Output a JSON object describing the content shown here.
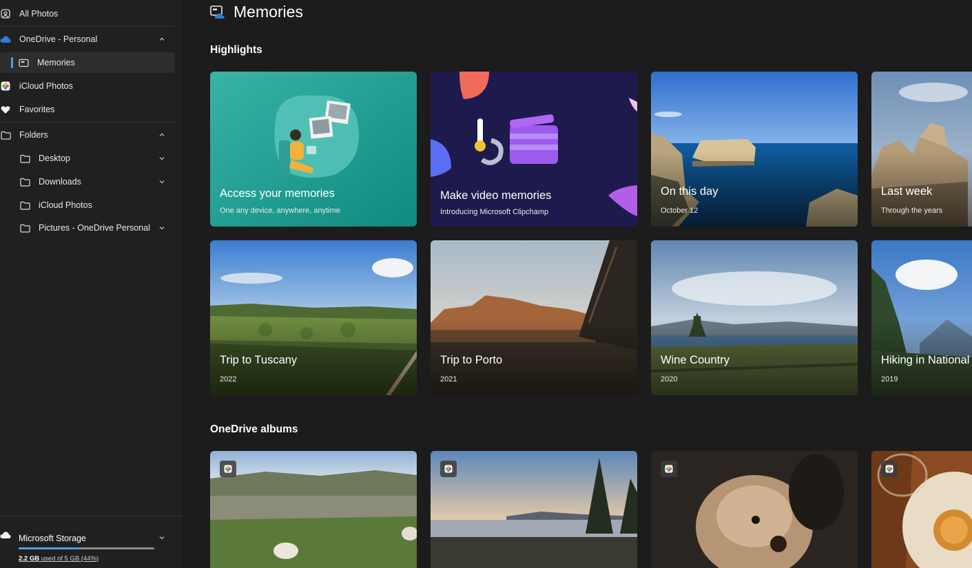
{
  "sidebar": {
    "items": [
      {
        "label": "All Photos",
        "icon": "all-photos-icon"
      },
      {
        "label": "OneDrive - Personal",
        "icon": "onedrive-cloud-icon",
        "chevron": "up"
      },
      {
        "label": "Memories",
        "icon": "memories-icon",
        "selected": true
      },
      {
        "label": "iCloud Photos",
        "icon": "icloud-photos-icon"
      },
      {
        "label": "Favorites",
        "icon": "heart-icon"
      },
      {
        "label": "Folders",
        "icon": "folder-icon",
        "chevron": "up"
      },
      {
        "label": "Desktop",
        "icon": "folder-icon",
        "chevron": "down"
      },
      {
        "label": "Downloads",
        "icon": "folder-icon",
        "chevron": "down"
      },
      {
        "label": "iCloud Photos",
        "icon": "folder-icon"
      },
      {
        "label": "Pictures - OneDrive Personal",
        "icon": "folder-icon",
        "chevron": "down"
      }
    ],
    "storage": {
      "title": "Microsoft Storage",
      "used": "2.2 GB",
      "rest": " used of 5 GB (44%)",
      "fraction": 0.44
    }
  },
  "main": {
    "title": "Memories",
    "highlights_title": "Highlights",
    "albums_title": "OneDrive albums",
    "highlights": [
      {
        "title": "Access your memories",
        "subtitle": "One any device, anywhere, anytime"
      },
      {
        "title": "Make video memories",
        "subtitle": "Introducing Microsoft Clipchamp"
      },
      {
        "title": "On this day",
        "subtitle": "October 12"
      },
      {
        "title": "Last week",
        "subtitle": "Through the years"
      },
      {
        "title": "Trip to Tuscany",
        "subtitle": "2022"
      },
      {
        "title": "Trip to Porto",
        "subtitle": "2021"
      },
      {
        "title": "Wine Country",
        "subtitle": "2020"
      },
      {
        "title": "Hiking in National",
        "subtitle": "2019"
      }
    ]
  },
  "colors": {
    "accent": "#4aa0e6",
    "sidebar_bg": "#202020",
    "main_bg": "#1c1c1c"
  }
}
